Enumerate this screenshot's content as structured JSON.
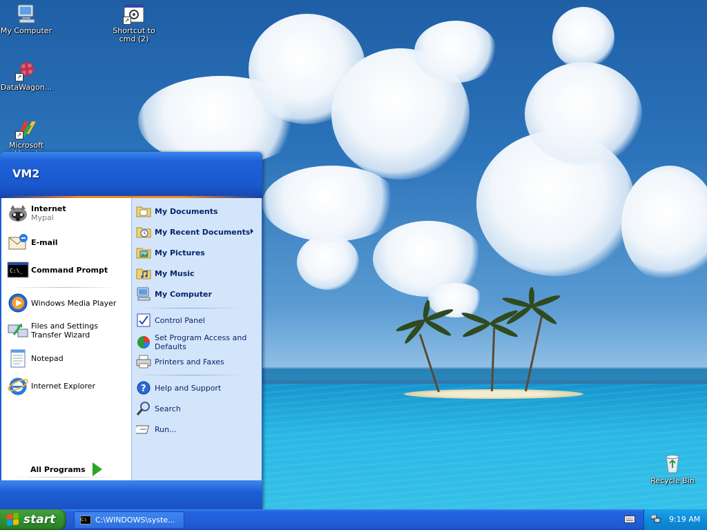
{
  "desktop": {
    "icons": [
      {
        "label": "My Computer"
      },
      {
        "label": "Shortcut to cmd (2)"
      },
      {
        "label": "DataWagon..."
      },
      {
        "label": "Microsoft Visual"
      },
      {
        "label": "Recycle Bin"
      }
    ]
  },
  "start_menu": {
    "user_name": "VM2",
    "pinned": [
      {
        "label": "Internet",
        "sub": "Mypal",
        "icon": "raccoon-browser-icon"
      },
      {
        "label": "E-mail",
        "icon": "email-icon"
      },
      {
        "label": "Command Prompt",
        "icon": "command-prompt-icon"
      }
    ],
    "recent": [
      {
        "label": "Windows Media Player",
        "icon": "media-player-icon"
      },
      {
        "label": "Files and Settings Transfer Wizard",
        "icon": "transfer-wizard-icon"
      },
      {
        "label": "Notepad",
        "icon": "notepad-icon"
      },
      {
        "label": "Internet Explorer",
        "icon": "internet-explorer-icon"
      }
    ],
    "all_programs_label": "All Programs",
    "right_column": {
      "places": [
        {
          "label": "My Documents",
          "icon": "folder-documents-icon"
        },
        {
          "label": "My Recent Documents",
          "icon": "recent-documents-icon"
        },
        {
          "label": "My Pictures",
          "icon": "folder-pictures-icon"
        },
        {
          "label": "My Music",
          "icon": "folder-music-icon"
        },
        {
          "label": "My Computer",
          "icon": "computer-icon"
        }
      ],
      "settings": [
        {
          "label": "Control Panel",
          "icon": "control-panel-icon"
        },
        {
          "label": "Set Program Access and Defaults",
          "icon": "program-defaults-icon"
        },
        {
          "label": "Printers and Faxes",
          "icon": "printer-icon"
        }
      ],
      "tools": [
        {
          "label": "Help and Support",
          "icon": "help-icon"
        },
        {
          "label": "Search",
          "icon": "search-icon"
        },
        {
          "label": "Run...",
          "icon": "run-icon"
        }
      ]
    }
  },
  "taskbar": {
    "start_label": "start",
    "task_label": "C:\\WINDOWS\\syste...",
    "clock": "9:19 AM"
  },
  "colors": {
    "accent_blue": "#1f5fd8",
    "start_green": "#3b9a36",
    "right_panel": "#d3e5fa",
    "tray_blue": "#0f8ddb"
  }
}
